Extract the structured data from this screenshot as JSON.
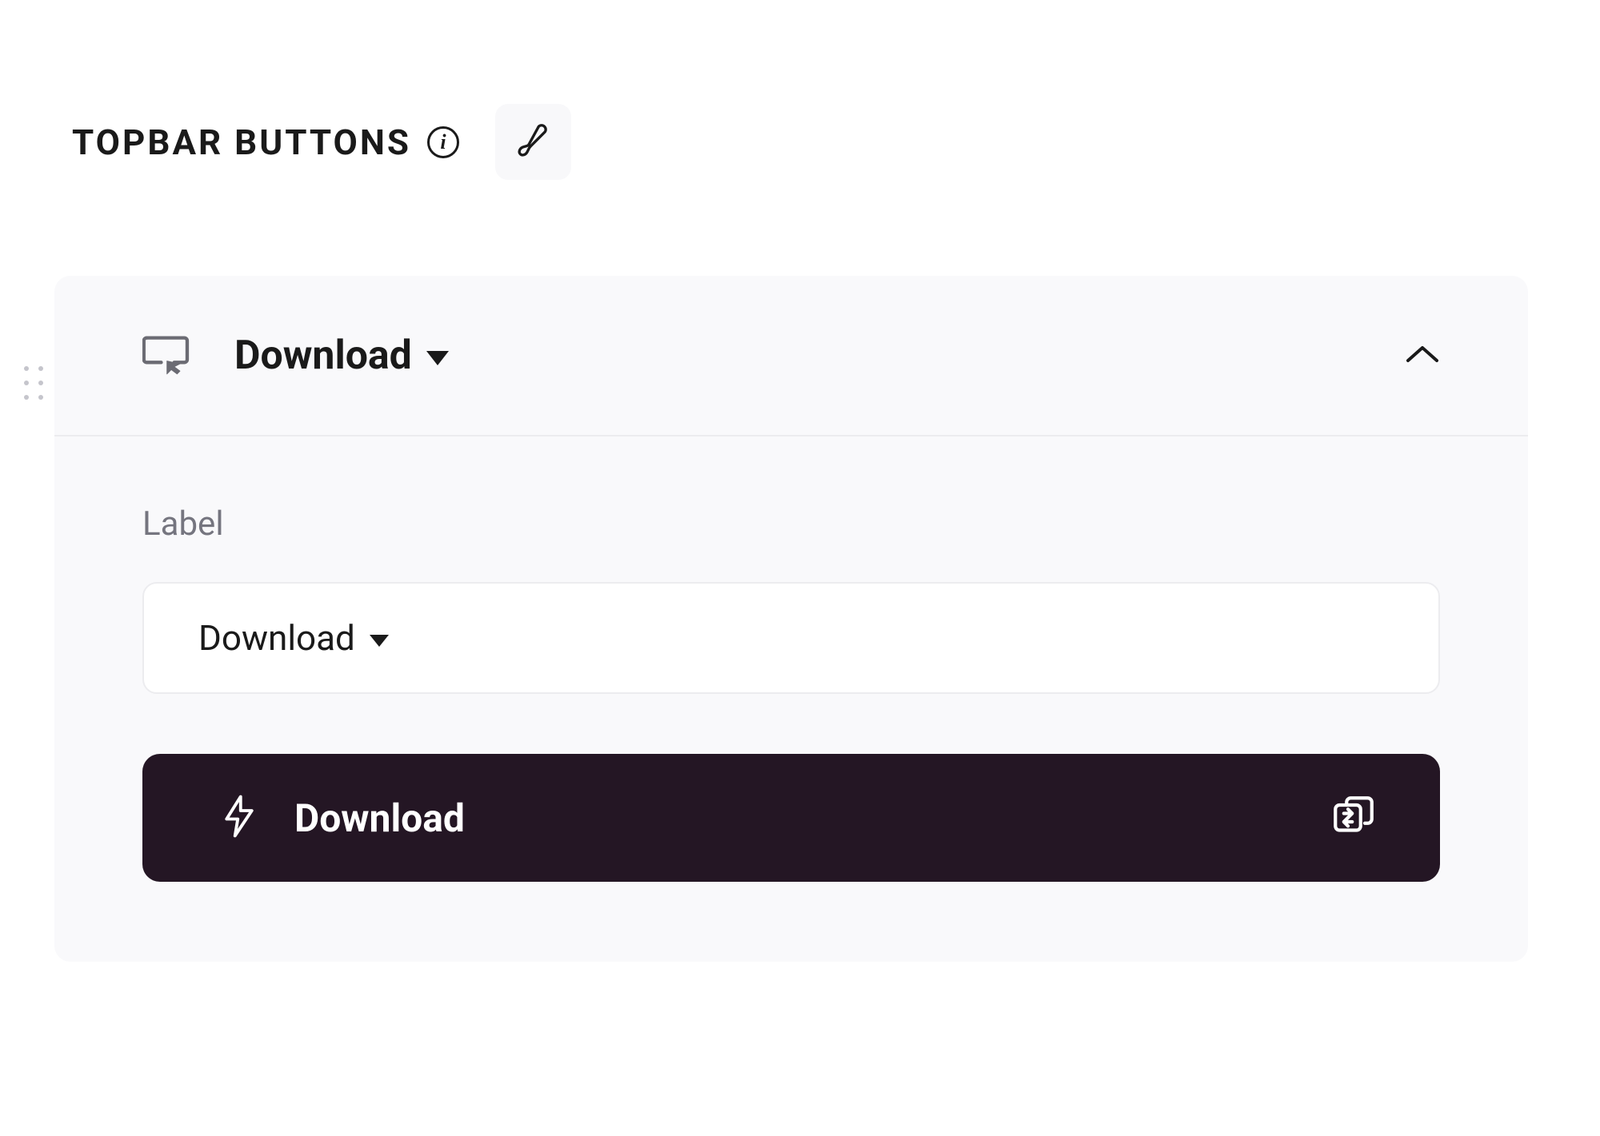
{
  "section": {
    "title": "TOPBAR BUTTONS"
  },
  "panel": {
    "title": "Download",
    "fields": {
      "label": {
        "title": "Label",
        "value": "Download"
      }
    },
    "action": {
      "label": "Download"
    }
  }
}
